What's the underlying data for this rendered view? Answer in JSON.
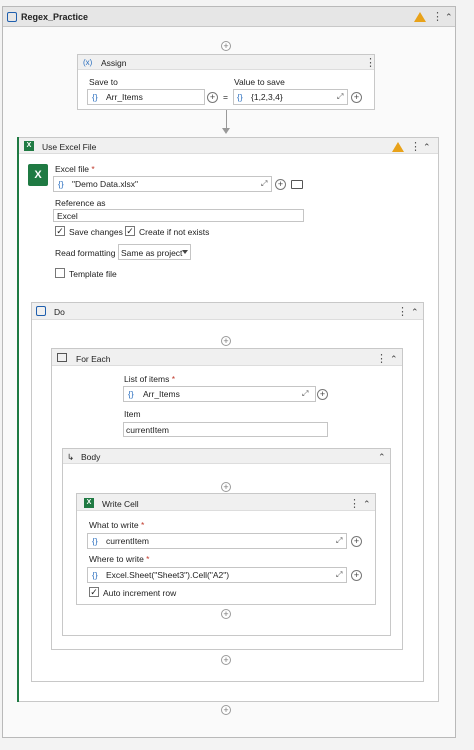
{
  "workflow": {
    "title": "Regex_Practice"
  },
  "assign": {
    "title": "Assign",
    "icon": "(x)",
    "save_to_label": "Save to",
    "save_to_value": "Arr_Items",
    "value_to_save_label": "Value to save",
    "value_to_save_value": "{1,2,3,4}",
    "equals": "="
  },
  "excel": {
    "title": "Use Excel File",
    "excel_file_label": "Excel file",
    "excel_file_value": "\"Demo Data.xlsx\"",
    "reference_as_label": "Reference as",
    "reference_as_value": "Excel",
    "save_changes_label": "Save changes",
    "create_if_not_exists_label": "Create if not exists",
    "read_formatting_label": "Read formatting",
    "read_formatting_value": "Same as project",
    "template_file_label": "Template file"
  },
  "do": {
    "title": "Do"
  },
  "foreach": {
    "title": "For Each",
    "list_label": "List of items",
    "list_value": "Arr_Items",
    "item_label": "Item",
    "item_value": "currentItem"
  },
  "body": {
    "title": "Body"
  },
  "writecell": {
    "title": "Write Cell",
    "what_label": "What to write",
    "what_value": "currentItem",
    "where_label": "Where to write",
    "where_value": "Excel.Sheet(\"Sheet3\").Cell(\"A2\")",
    "auto_increment_label": "Auto increment row"
  },
  "glyphs": {
    "required": "*",
    "braces": "{}",
    "check": "✓",
    "plus": "+",
    "dots": "⋮",
    "collapse": "⌃",
    "expand": "⤢"
  },
  "colors": {
    "warning": "#e8a21a",
    "excel_green": "#1f7a43",
    "accent_blue": "#2b6fbf",
    "required_red": "#c0392b"
  }
}
